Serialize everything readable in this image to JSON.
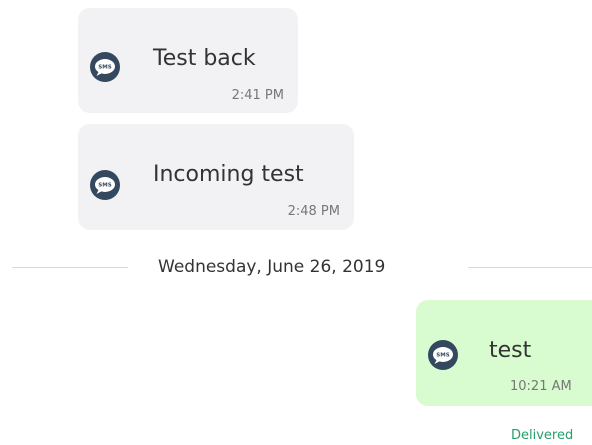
{
  "colors": {
    "incoming_bubble": "#f2f2f4",
    "outgoing_bubble": "#d8fbd0",
    "sms_icon": "#34495e",
    "delivered_status": "#25a06a",
    "separator_line": "#d9d9d9"
  },
  "messages": [
    {
      "direction": "incoming",
      "icon": "sms-chat-icon",
      "text": "Test back",
      "time": "2:41 PM"
    },
    {
      "direction": "incoming",
      "icon": "sms-chat-icon",
      "text": "Incoming test",
      "time": "2:48 PM"
    },
    {
      "direction": "outgoing",
      "icon": "sms-chat-icon",
      "text": "test",
      "time": "10:21 AM",
      "status": "Delivered"
    }
  ],
  "date_separator": {
    "label": "Wednesday, June 26, 2019"
  }
}
